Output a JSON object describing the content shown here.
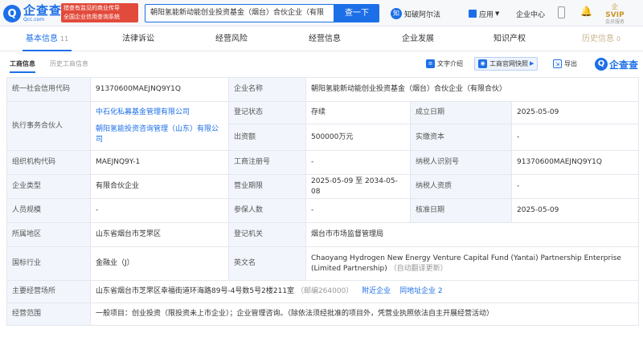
{
  "topbar": {
    "logo_name": "企查查",
    "logo_domain": "Qcc.com",
    "badge_line1": "猎查有监见的商业传导",
    "badge_line2": "全国企业信用查询系统",
    "search_value": "朝阳氢能新动能创业投资基金（烟台）合伙企业（有限",
    "search_button": "查一下",
    "zhi_label": "知破阿尔法",
    "zhi_icon": "知",
    "app_label": "应用",
    "user_center": "企业中心",
    "svip_top": "企",
    "svip_label": "SVIP",
    "svip_sub": "会员服务"
  },
  "tabs": [
    {
      "label": "基本信息",
      "count": "11"
    },
    {
      "label": "法律诉讼"
    },
    {
      "label": "经营风险"
    },
    {
      "label": "经营信息"
    },
    {
      "label": "企业发展"
    },
    {
      "label": "知识产权"
    },
    {
      "label": "历史信息",
      "count": "0"
    }
  ],
  "subbar": {
    "tab1": "工商信息",
    "tab2": "历史工商信息",
    "act_intro": "文字介绍",
    "act_snapshot": "工商官网快照",
    "act_export": "导出",
    "logo_name": "企查查"
  },
  "info": {
    "uscc_label": "统一社会信用代码",
    "uscc": "91370600MAEJNQ9Y1Q",
    "name_label": "企业名称",
    "name": "朝阳氢能新动能创业投资基金（烟台）合伙企业（有限合伙）",
    "partner_label": "执行事务合伙人",
    "partner1": "中石化私募基金管理有限公司",
    "partner2": "朝阳氢能投资咨询管理（山东）有限公司",
    "status_label": "登记状态",
    "status": "存续",
    "founded_label": "成立日期",
    "founded": "2025-05-09",
    "capital_label": "出资额",
    "capital": "500000万元",
    "paid_label": "实缴资本",
    "paid": "-",
    "org_label": "组织机构代码",
    "org": "MAEJNQ9Y-1",
    "reg_no_label": "工商注册号",
    "reg_no": "-",
    "tax_label": "纳税人识别号",
    "tax": "91370600MAEJNQ9Y1Q",
    "type_label": "企业类型",
    "type": "有限合伙企业",
    "term_label": "营业期限",
    "term": "2025-05-09 至 2034-05-08",
    "taxq_label": "纳税人资质",
    "taxq": "-",
    "staff_label": "人员规模",
    "staff": "-",
    "insured_label": "参保人数",
    "insured": "-",
    "approve_label": "核准日期",
    "approve": "2025-05-09",
    "region_label": "所属地区",
    "region": "山东省烟台市芝罘区",
    "authority_label": "登记机关",
    "authority": "烟台市市场监督管理局",
    "industry_label": "国标行业",
    "industry": "金融业（J）",
    "en_label": "英文名",
    "en_name": "Chaoyang Hydrogen New Energy Venture Capital Fund (Yantai) Partnership Enterprise (Limited Partnership)",
    "en_note": "（自动翻译更新）",
    "address_label": "主要经营场所",
    "address": "山东省烟台市芝罘区幸福街道环海路89号-4号数5号2楼211室",
    "postcode": "（邮编264000）",
    "nearby": "附近企业",
    "same_addr": "同地址企业 2",
    "scope_label": "经营范围",
    "scope": "一般项目：创业投资（限投资未上市企业）；企业管理咨询。（除依法须经批准的项目外，凭营业执照依法自主开展经营活动）"
  }
}
